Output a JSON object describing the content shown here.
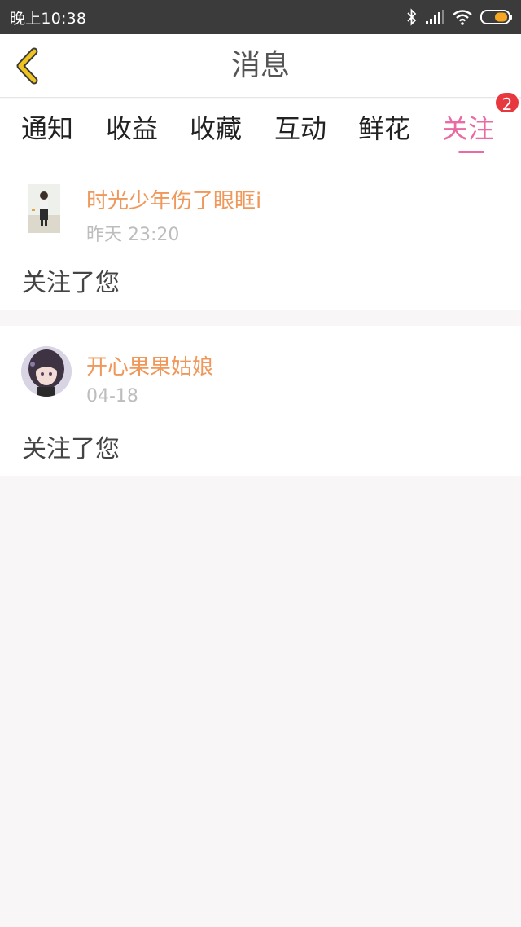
{
  "status_bar": {
    "time": "晚上10:38",
    "icons": [
      "bluetooth-icon",
      "signal-icon",
      "wifi-icon",
      "battery-icon"
    ]
  },
  "header": {
    "title": "消息",
    "back_icon": "chevron-left-icon"
  },
  "tabs": [
    {
      "label": "通知"
    },
    {
      "label": "收益"
    },
    {
      "label": "收藏"
    },
    {
      "label": "互动"
    },
    {
      "label": "鲜花"
    },
    {
      "label": "关注",
      "active": true,
      "badge": "2"
    }
  ],
  "notifications": [
    {
      "username": "时光少年伤了眼眶i",
      "time": "昨天 23:20",
      "message": "关注了您"
    },
    {
      "username": "开心果果姑娘",
      "time": "04-18",
      "message": "关注了您"
    }
  ],
  "colors": {
    "accent": "#ea6ba3",
    "username": "#f0975a",
    "badge": "#e8383f",
    "back_icon": "#f0c420"
  }
}
